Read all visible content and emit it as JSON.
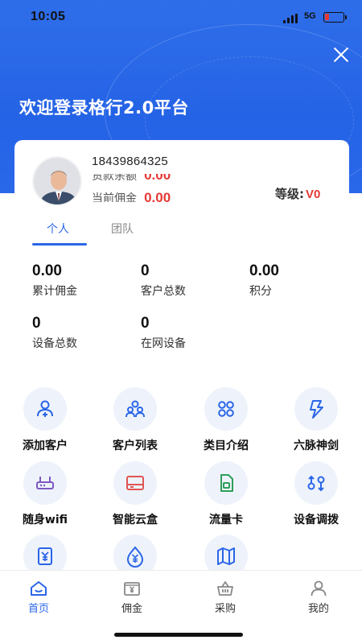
{
  "status_bar": {
    "time": "10:05",
    "network": "5G"
  },
  "header": {
    "welcome_text": "欢迎登录格行2.0平台"
  },
  "profile": {
    "phone": "18439864325",
    "balance_label": "货款余额",
    "balance_value": "0.00",
    "commission_label": "当前佣金",
    "commission_value": "0.00",
    "level_label": "等级:",
    "level_value": "V0"
  },
  "tabs": [
    {
      "label": "个人",
      "active": true
    },
    {
      "label": "团队",
      "active": false
    }
  ],
  "stats": [
    {
      "value": "0.00",
      "label": "累计佣金"
    },
    {
      "value": "0",
      "label": "客户总数"
    },
    {
      "value": "0.00",
      "label": "积分"
    },
    {
      "value": "0",
      "label": "设备总数"
    },
    {
      "value": "0",
      "label": "在网设备"
    }
  ],
  "grid": [
    {
      "label": "添加客户",
      "icon": "add-customer-icon"
    },
    {
      "label": "客户列表",
      "icon": "customer-list-icon"
    },
    {
      "label": "类目介绍",
      "icon": "category-icon"
    },
    {
      "label": "六脉神剑",
      "icon": "lightning-icon"
    },
    {
      "label": "随身wifi",
      "icon": "router-icon"
    },
    {
      "label": "智能云盒",
      "icon": "cloud-box-icon"
    },
    {
      "label": "流量卡",
      "icon": "sim-card-icon"
    },
    {
      "label": "设备调拨",
      "icon": "device-transfer-icon"
    },
    {
      "label": "",
      "icon": "yuan-document-icon"
    },
    {
      "label": "",
      "icon": "yuan-drop-icon"
    },
    {
      "label": "",
      "icon": "map-icon"
    }
  ],
  "bottom_nav": [
    {
      "label": "首页",
      "icon": "home-icon",
      "active": true
    },
    {
      "label": "佣金",
      "icon": "commission-icon",
      "active": false
    },
    {
      "label": "采购",
      "icon": "basket-icon",
      "active": false
    },
    {
      "label": "我的",
      "icon": "profile-icon",
      "active": false
    }
  ],
  "colors": {
    "brand_blue": "#2b66e8",
    "accent_red": "#e53935",
    "icon_bg": "#eef3fb"
  }
}
